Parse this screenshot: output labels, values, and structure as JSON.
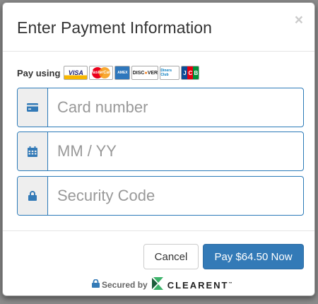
{
  "modal": {
    "title": "Enter Payment Information",
    "close_label": "×"
  },
  "pay_using": {
    "label": "Pay using",
    "card_logos": [
      {
        "name": "visa",
        "text": "VISA"
      },
      {
        "name": "mastercard",
        "text": "MasterCard"
      },
      {
        "name": "amex",
        "text": "AMEX"
      },
      {
        "name": "discover",
        "text": "DISC",
        "text2": "VER"
      },
      {
        "name": "diners-club",
        "text": "Diners Club"
      },
      {
        "name": "jcb",
        "letters": [
          "J",
          "C",
          "B"
        ]
      }
    ]
  },
  "fields": {
    "card_number": {
      "placeholder": "Card number",
      "value": "",
      "icon": "credit-card-icon"
    },
    "expiry": {
      "placeholder": "MM / YY",
      "value": "",
      "icon": "calendar-icon"
    },
    "security_code": {
      "placeholder": "Security Code",
      "value": "",
      "icon": "lock-icon"
    }
  },
  "footer": {
    "cancel_label": "Cancel",
    "pay_label": "Pay $64.50 Now",
    "secured_label": "Secured by",
    "brand_name": "CLEARENT",
    "brand_tm": "™"
  },
  "colors": {
    "primary": "#337ab7",
    "field_border": "#2b7ab8",
    "icon": "#337ab7",
    "brand_green_dark": "#1b5e3b",
    "brand_green_light": "#3db36b"
  }
}
